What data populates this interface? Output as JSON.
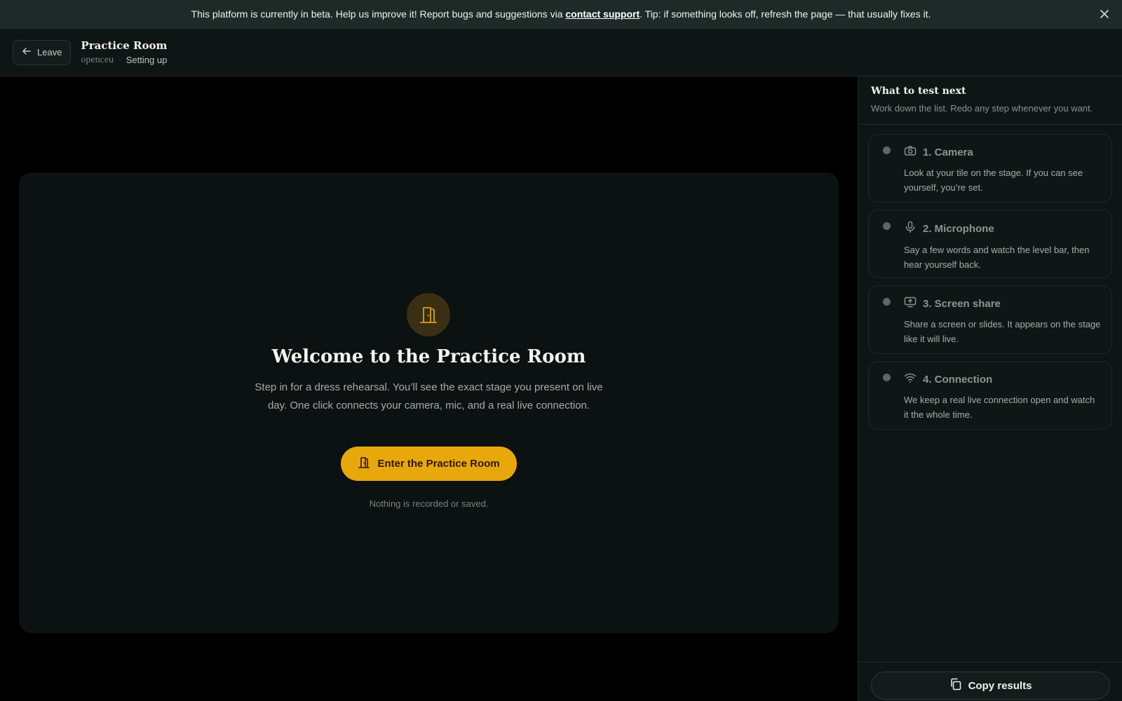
{
  "banner": {
    "text_before": "This platform is currently in beta. Help us improve it! Report bugs and suggestions via ",
    "link": "contact support",
    "text_after": ". Tip: if something looks off, refresh the page — that usually fixes it."
  },
  "header": {
    "leave_label": "Leave",
    "title": "Practice Room",
    "org": "openceu",
    "separator": "·",
    "status": "Setting up"
  },
  "welcome": {
    "title": "Welcome to the Practice Room",
    "body": "Step in for a dress rehearsal. You’ll see the exact stage you present on live day. One click connects your camera, mic, and a real live connection.",
    "button": "Enter the Practice Room",
    "note": "Nothing is recorded or saved."
  },
  "sidebar": {
    "title": "What to test next",
    "subtitle": "Work down the list. Redo any step whenever you want.",
    "steps": [
      {
        "title": "1. Camera",
        "icon": "camera-icon",
        "desc": "Look at your tile on the stage. If you can see yourself, you’re set."
      },
      {
        "title": "2. Microphone",
        "icon": "microphone-icon",
        "desc": "Say a few words and watch the level bar, then hear yourself back."
      },
      {
        "title": "3. Screen share",
        "icon": "screen-share-icon",
        "desc": "Share a screen or slides. It appears on the stage like it will live."
      },
      {
        "title": "4. Connection",
        "icon": "wifi-icon",
        "desc": "We keep a real live connection open and watch it the whole time."
      }
    ],
    "copy_label": "Copy results"
  },
  "colors": {
    "accent": "#e8a70b",
    "background": "#000000",
    "panel": "#0e1615"
  }
}
